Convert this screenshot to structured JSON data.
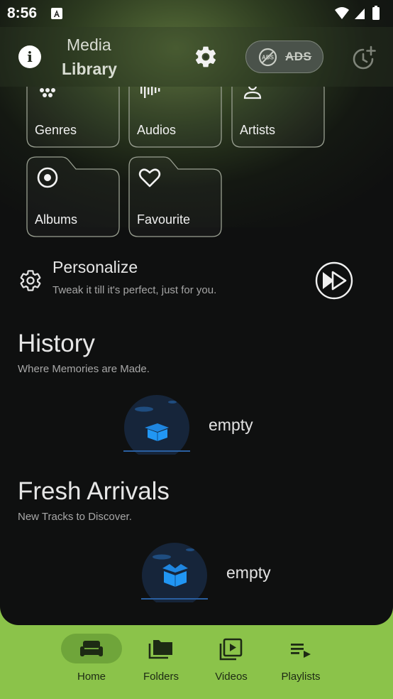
{
  "status_bar": {
    "time": "8:56"
  },
  "header": {
    "title_line1": "Media",
    "title_line2": "Library",
    "ads_label": "ADS",
    "ads_badge": "ADS"
  },
  "tiles": [
    {
      "label": "Genres",
      "icon": "genres-icon"
    },
    {
      "label": "Audios",
      "icon": "audio-wave-icon"
    },
    {
      "label": "Artists",
      "icon": "person-icon"
    },
    {
      "label": "Albums",
      "icon": "disc-icon"
    },
    {
      "label": "Favourite",
      "icon": "heart-icon"
    }
  ],
  "personalize": {
    "title": "Personalize",
    "subtitle": "Tweak it till it's perfect, just for you."
  },
  "history": {
    "title": "History",
    "subtitle": "Where Memories are Made.",
    "empty_label": "empty"
  },
  "fresh_arrivals": {
    "title": "Fresh Arrivals",
    "subtitle": "New Tracks to Discover.",
    "empty_label": "empty"
  },
  "bottom_nav": {
    "items": [
      {
        "label": "Home",
        "icon": "sofa-icon",
        "selected": true
      },
      {
        "label": "Folders",
        "icon": "folders-icon",
        "selected": false
      },
      {
        "label": "Videos",
        "icon": "video-library-icon",
        "selected": false
      },
      {
        "label": "Playlists",
        "icon": "playlist-icon",
        "selected": false
      }
    ]
  },
  "colors": {
    "nav_background": "#8bc34a",
    "nav_selected_pill": "#6fa53a",
    "app_background": "#0f1010",
    "accent_blue": "#2196f3"
  }
}
